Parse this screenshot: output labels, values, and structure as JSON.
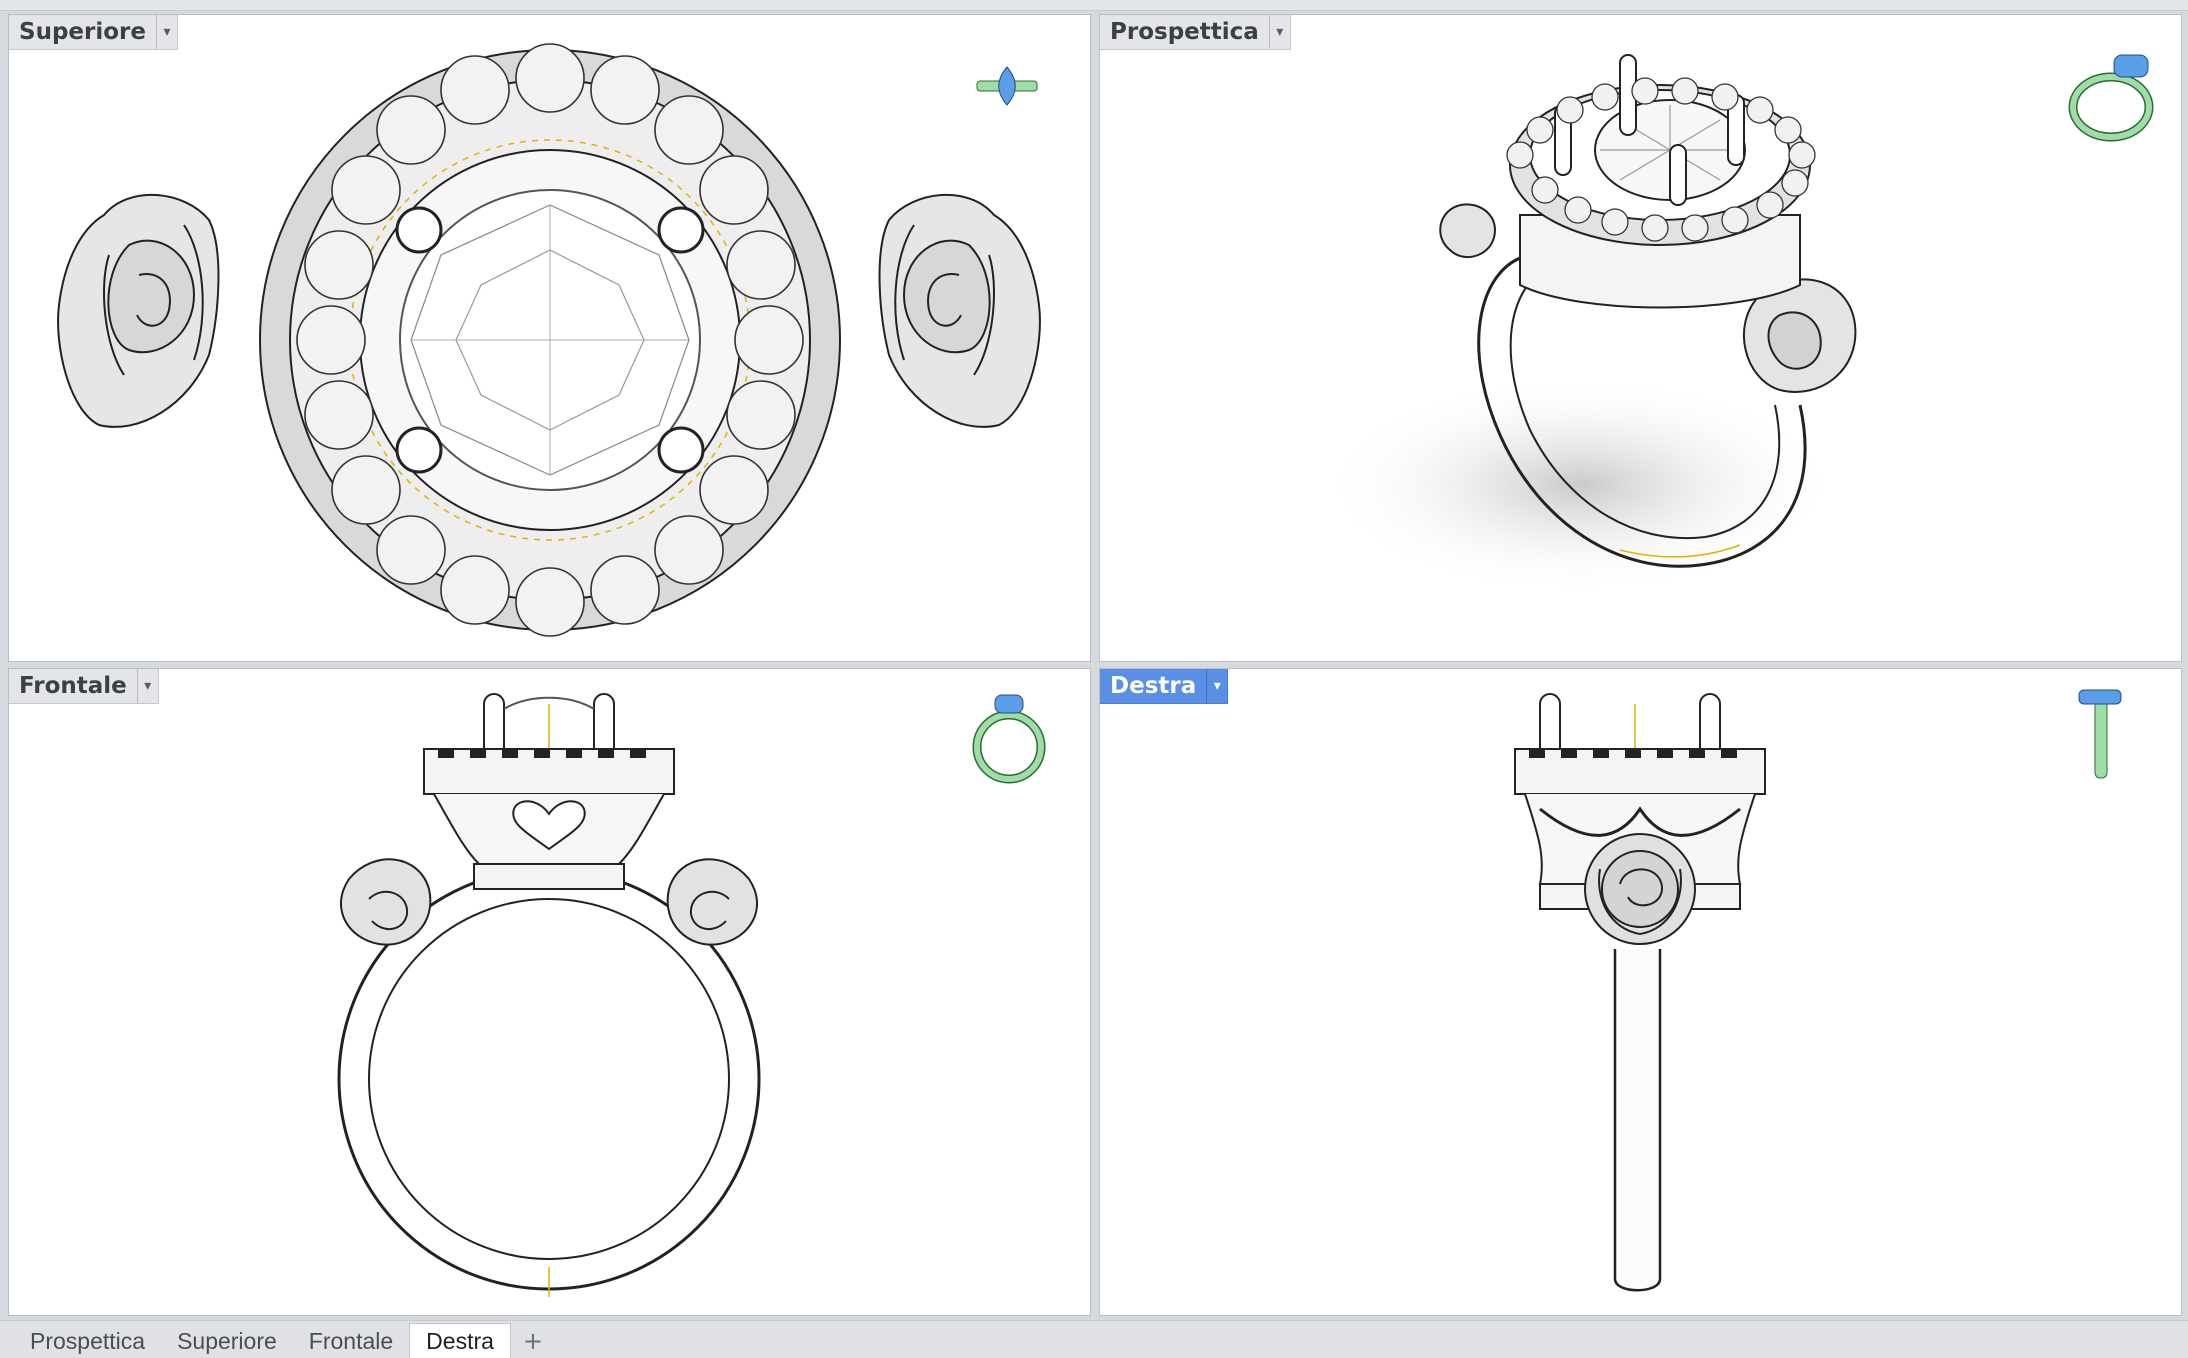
{
  "viewports": {
    "top": {
      "title": "Superiore"
    },
    "persp": {
      "title": "Prospettica"
    },
    "front": {
      "title": "Frontale"
    },
    "right": {
      "title": "Destra"
    }
  },
  "active_viewport": "right",
  "tabs": [
    {
      "label": "Prospettica"
    },
    {
      "label": "Superiore"
    },
    {
      "label": "Frontale"
    },
    {
      "label": "Destra",
      "active": true
    }
  ],
  "add_tab_glyph": "+",
  "dropdown_glyph": "▾",
  "colors": {
    "active_title": "#5a8fe6",
    "gizmo_green": "#9fdca6",
    "gizmo_blue": "#5b9ee8",
    "curve_yellow": "#e0b400"
  },
  "icons": [
    "dropdown-arrow-icon",
    "view-gizmo-icon",
    "plus-icon"
  ]
}
